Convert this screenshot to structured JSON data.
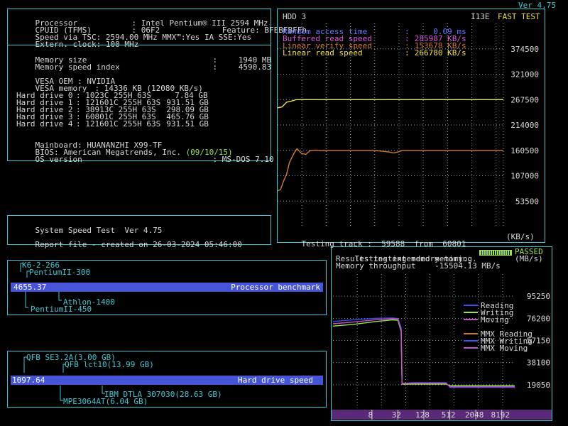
{
  "version": "Ver 4.75",
  "sysinfo": {
    "processor": {
      "label": "Processor",
      "sep": ":",
      "value": "Intel Pentium® III 2594 MHz"
    },
    "cpuid": {
      "label": "CPUID (TFMS)",
      "sep": ":",
      "value": "06F2",
      "feature_label": "Feature:",
      "feature_value": "BFEBFBFFh"
    },
    "speed_tsc": {
      "label": "Speed via TSC:",
      "value": "2594.00 MHz",
      "mmx": "MMX™:Yes",
      "ia_sse": "IA SSE:Yes"
    },
    "extern_clock": {
      "label": "Extern. clock:",
      "value": "100 MHz"
    },
    "memory_size": {
      "label": "Memory size",
      "sep": ":",
      "value": "1940 MB"
    },
    "memory_speed": {
      "label": "Memory speed index",
      "sep": ":",
      "value": "4590.83"
    },
    "vesa_oem": {
      "label": "VESA OEM",
      "sep": ":",
      "value": "NVIDIA"
    },
    "vesa_memory": {
      "label": "VESA memory",
      "sep": ":",
      "value": "14336 KB (12080 KB/s)"
    },
    "hard_drives": [
      {
        "label": "Hard drive 0",
        "sep": ":",
        "geometry": "1023C 255H 63S",
        "size": "7.84 GB"
      },
      {
        "label": "Hard drive 1",
        "sep": ":",
        "geometry": "121601C 255H 63S",
        "size": "931.51 GB"
      },
      {
        "label": "Hard drive 2",
        "sep": ":",
        "geometry": "38913C 255H 63S",
        "size": "298.09 GB"
      },
      {
        "label": "Hard drive 3",
        "sep": ":",
        "geometry": "60801C 255H 63S",
        "size": "465.76 GB"
      },
      {
        "label": "Hard drive 4",
        "sep": ":",
        "geometry": "121601C 255H 63S",
        "size": "931.51 GB"
      }
    ],
    "mainboard": {
      "label": "Mainboard:",
      "value": "HUANANZHI X99-TF"
    },
    "bios": {
      "label": "BIOS:",
      "value": "American Megatrends, Inc.",
      "date": "(09/10/15)"
    },
    "os": {
      "label": "OS version",
      "sep": ":",
      "value": "MS-DOS 7.10"
    }
  },
  "speedtest": {
    "title": "System Speed Test",
    "version": "Ver 4.75",
    "report_label": "Report file - created on",
    "report_date": "26-03-2024 05:46:00"
  },
  "cpu_bench": {
    "score": "4655.37",
    "label": "Processor benchmark",
    "refs": [
      "K6-2-266",
      "PentiumII-300",
      "Athlon-1400",
      "PentiumII-450"
    ]
  },
  "hdd_bench": {
    "score": "1097.64",
    "label": "Hard drive speed",
    "refs": [
      "QFB SE3.2A(3.00 GB)",
      "QFB lct10(13.99 GB)",
      "IBM DTLA 307030(28.63 GB)",
      "MPE3064AT(6.04 GB)"
    ]
  },
  "hdd_test": {
    "drive": "HDD 3",
    "mode": "I13E",
    "test_name": "FAST TEST",
    "rows": [
      {
        "label": "Random access time",
        "sep": ":",
        "value": "0.09 ms"
      },
      {
        "label": "Buffered read speed",
        "sep": ":",
        "value": "285987 KB/s"
      },
      {
        "label": "Linear verify speed",
        "sep": ":",
        "value": "153678 KB/s"
      },
      {
        "label": "Linear read speed",
        "sep": ":",
        "value": "266780 KB/s"
      }
    ],
    "track_label": "Testing track :",
    "track_value": "59588",
    "from_label": "from",
    "from_value": "60801",
    "unit": "(KB/s)"
  },
  "mem_test": {
    "line1": "Testing extended memory...",
    "status": "PASSED",
    "line2": "Results testing memory-timing",
    "unit": "(MB/s)",
    "line3_label": "Memory throughput",
    "line3_value": "-15504.13 MB/s",
    "legend": [
      "Reading",
      "Writing",
      "Moving",
      "MMX Reading",
      "MMX Writing",
      "MMX Moving"
    ]
  },
  "colors": {
    "frame": "#3cc8d4",
    "text": "#d8d8d8",
    "blue": "#3c4cf0",
    "green": "#96e64c",
    "magenta": "#c850c8",
    "orange": "#d27a2e",
    "yellow": "#f0e040",
    "grid": "#8aa0a0",
    "bar": "#4654d8"
  },
  "chart_data": [
    {
      "type": "line",
      "title": "HDD 3",
      "ylabel": "(KB/s)",
      "xlabel": "",
      "yticks": [
        53500,
        107000,
        160500,
        214000,
        267500,
        321000,
        374500
      ],
      "ylim": [
        0,
        428000
      ],
      "xlim": [
        0,
        60801
      ],
      "grid": true,
      "series": [
        {
          "name": "Linear read speed",
          "color": "#f0e040",
          "x": [
            0,
            1200,
            2400,
            3600,
            4000,
            5000,
            6000,
            60801
          ],
          "y": [
            250000,
            252000,
            262000,
            264000,
            265000,
            267500,
            267500,
            267500
          ]
        },
        {
          "name": "Linear verify speed",
          "color": "#d27a2e",
          "x": [
            0,
            800,
            1600,
            2400,
            3200,
            4400,
            5200,
            6400,
            7600,
            8800,
            10400,
            12000,
            14000,
            18000,
            26000,
            30000,
            31200,
            32400,
            33600,
            60801
          ],
          "y": [
            75000,
            78000,
            96000,
            110000,
            135000,
            154000,
            164000,
            154000,
            152000,
            160500,
            161000,
            160000,
            160500,
            160500,
            160500,
            157000,
            155000,
            157000,
            160500,
            160500
          ]
        }
      ]
    },
    {
      "type": "line",
      "xscale": "log2",
      "xticks": [
        8,
        32,
        128,
        512,
        2048,
        8192
      ],
      "yticks": [
        19050,
        38100,
        57150,
        76200,
        95250
      ],
      "ylim": [
        0,
        114300
      ],
      "grid": true,
      "series": [
        {
          "name": "Reading",
          "color": "#3c4cf0",
          "x": [
            1,
            3,
            10,
            24,
            32,
            38,
            40,
            70,
            128,
            250,
            420,
            512,
            2000,
            16384
          ],
          "y": [
            73500,
            75000,
            76200,
            76500,
            76000,
            68000,
            20000,
            20800,
            20800,
            20800,
            20800,
            16800,
            16800,
            16800
          ]
        },
        {
          "name": "Writing",
          "color": "#96e64c",
          "x": [
            1,
            3,
            10,
            24,
            32,
            38,
            40,
            70,
            128,
            250,
            420,
            512,
            2000,
            16384
          ],
          "y": [
            69500,
            71000,
            73500,
            74800,
            74500,
            65000,
            19500,
            19500,
            19500,
            19500,
            19500,
            18300,
            18300,
            18300
          ]
        },
        {
          "name": "Moving",
          "color": "#c850c8",
          "x": [
            1,
            3,
            10,
            24,
            32,
            38,
            40,
            70,
            128,
            250,
            420,
            512,
            2000,
            16384
          ],
          "y": [
            71500,
            73000,
            75000,
            75800,
            75600,
            66000,
            20200,
            20300,
            20300,
            20300,
            20300,
            17300,
            17300,
            17300
          ]
        }
      ]
    }
  ]
}
